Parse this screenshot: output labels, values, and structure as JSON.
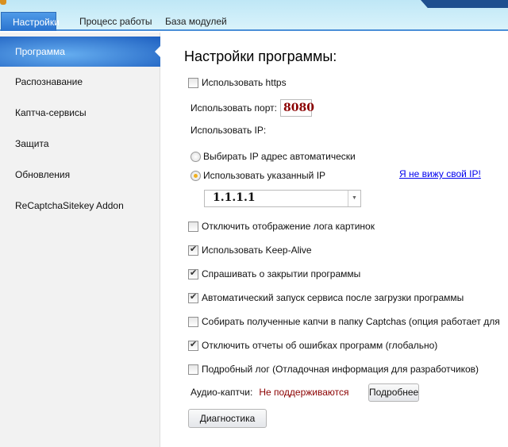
{
  "tabs": [
    {
      "label": "Настройки",
      "active": true
    },
    {
      "label": "Процесс работы"
    },
    {
      "label": "База модулей"
    }
  ],
  "sidebar": {
    "items": [
      {
        "label": "Программа"
      },
      {
        "label": "Распознавание"
      },
      {
        "label": "Каптча-сервисы"
      },
      {
        "label": "Защита"
      },
      {
        "label": "Обновления"
      },
      {
        "label": "ReCaptchaSitekey Addon"
      }
    ]
  },
  "main": {
    "title": "Настройки программы:",
    "use_https": {
      "label": "Использовать https",
      "checked": false
    },
    "port": {
      "label": "Использовать порт:",
      "value": "8080"
    },
    "ip_label": "Использовать IP:",
    "ip_auto": {
      "label": "Выбирать IP адрес автоматически",
      "selected": false
    },
    "ip_manual": {
      "label": "Использовать указанный IP",
      "selected": true
    },
    "ip_link": "Я не вижу свой IP!",
    "ip_value": "1.1.1.1",
    "options": [
      {
        "label": "Отключить отображение лога картинок",
        "checked": false
      },
      {
        "label": "Использовать Keep-Alive",
        "checked": true
      },
      {
        "label": "Спрашивать о закрытии программы",
        "checked": true
      },
      {
        "label": "Автоматический запуск сервиса после загрузки программы",
        "checked": true
      },
      {
        "label": "Собирать полученные капчи в папку Captchas (опция работает для",
        "checked": false
      },
      {
        "label": "Отключить отчеты об ошибках программ (глобально)",
        "checked": true
      },
      {
        "label": "Подробный лог (Отладочная информация для разработчиков)",
        "checked": false
      }
    ],
    "audio": {
      "label": "Аудио-каптчи:",
      "status": "Не поддерживаются",
      "details_button": "Подробнее",
      "status_color": "#8b0000"
    },
    "diagnostics_button": "Диагностика"
  }
}
